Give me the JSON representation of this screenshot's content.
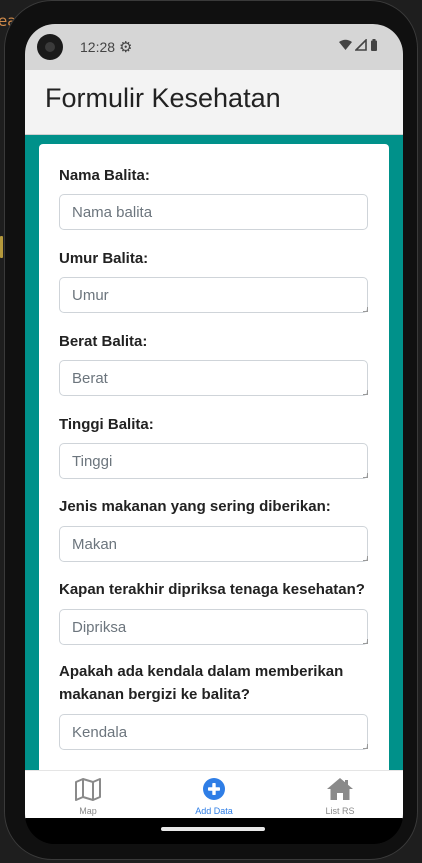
{
  "backdrop": {
    "partial_text": "ea"
  },
  "status_bar": {
    "time": "12:28",
    "icons": [
      "settings-icon",
      "wifi-icon",
      "signal-icon",
      "battery-icon"
    ]
  },
  "app_bar": {
    "title": "Formulir Kesehatan"
  },
  "form": {
    "fields": [
      {
        "label": "Nama Balita:",
        "placeholder": "Nama balita",
        "value": ""
      },
      {
        "label": "Umur Balita:",
        "placeholder": "Umur",
        "value": ""
      },
      {
        "label": "Berat Balita:",
        "placeholder": "Berat",
        "value": ""
      },
      {
        "label": "Tinggi Balita:",
        "placeholder": "Tinggi",
        "value": ""
      },
      {
        "label": "Jenis makanan yang sering diberikan:",
        "placeholder": "Makan",
        "value": ""
      },
      {
        "label": "Kapan terakhir dipriksa tenaga kesehatan?",
        "placeholder": "Dipriksa",
        "value": ""
      },
      {
        "label": "Apakah ada kendala dalam memberikan makanan bergizi ke balita?",
        "placeholder": "Kendala",
        "value": ""
      }
    ]
  },
  "bottom_nav": {
    "items": [
      {
        "label": "Map",
        "icon": "map-icon",
        "active": false
      },
      {
        "label": "Add Data",
        "icon": "plus-circle-icon",
        "active": true
      },
      {
        "label": "List RS",
        "icon": "home-icon",
        "active": false
      }
    ]
  },
  "colors": {
    "accent": "#2f7ee6",
    "content_background": "#00918a",
    "app_bar_background": "#f3f3f3",
    "inactive_nav": "#8a8a8a"
  }
}
